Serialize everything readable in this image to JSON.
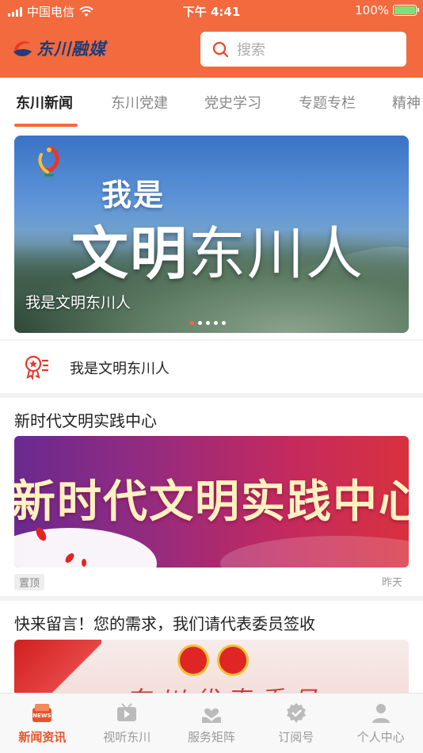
{
  "status_bar": {
    "carrier": "中国电信",
    "time": "下午 4:41",
    "battery": "100%"
  },
  "header": {
    "app_name": "东川融媒",
    "search_placeholder": "搜索",
    "brand_color": "#f26a3d"
  },
  "tabs": [
    {
      "label": "东川新闻",
      "active": true
    },
    {
      "label": "东川党建",
      "active": false
    },
    {
      "label": "党史学习",
      "active": false
    },
    {
      "label": "专题专栏",
      "active": false
    },
    {
      "label": "精神",
      "active": false
    }
  ],
  "banner": {
    "line1": "我是",
    "line2_bold": "文明",
    "line2_rest": "东川人",
    "caption": "我是文明东川人",
    "slide_count": 5,
    "active_slide": 1
  },
  "topic_row": {
    "label": "我是文明东川人"
  },
  "articles": [
    {
      "title": "新时代文明实践中心",
      "image_text": "新时代文明实践中心",
      "tag": "置顶",
      "time": "昨天"
    },
    {
      "title": "快来留言！您的需求，我们请代表委员签收",
      "image_text": "东川代表委员"
    }
  ],
  "tab_bar": [
    {
      "label": "新闻资讯",
      "icon": "news-icon",
      "active": true
    },
    {
      "label": "视听东川",
      "icon": "video-icon",
      "active": false
    },
    {
      "label": "服务矩阵",
      "icon": "service-icon",
      "active": false
    },
    {
      "label": "订阅号",
      "icon": "subscribe-icon",
      "active": false
    },
    {
      "label": "个人中心",
      "icon": "user-icon",
      "active": false
    }
  ]
}
